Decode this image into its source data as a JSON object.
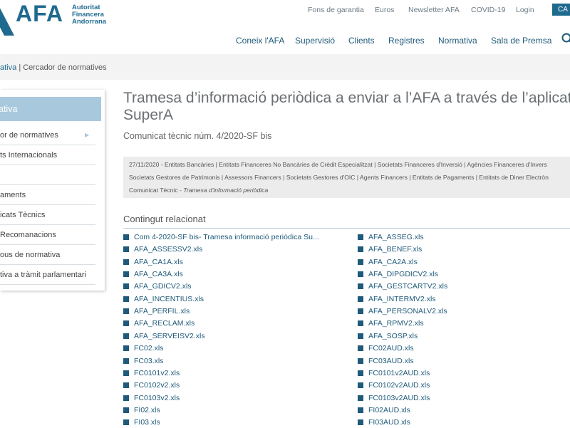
{
  "header": {
    "logo": {
      "text": "AFA",
      "sub_line1": "Autoritat",
      "sub_line2": "Financera",
      "sub_line3": "Andorrana"
    },
    "utility_nav": [
      "Fons de garantia",
      "Euros",
      "Newsletter AFA",
      "COVID-19",
      "Login"
    ],
    "utility_button": "CA",
    "main_nav": [
      "Coneix l'AFA",
      "Supervisió",
      "Clients",
      "Registres",
      "Normativa",
      "Sala de Premsa"
    ],
    "search_icon": "search-icon"
  },
  "breadcrumb": {
    "link": "ativa",
    "separator": "|",
    "current": "Cercador de normatives"
  },
  "sidebar": {
    "header": "ativa",
    "items": [
      {
        "label": "or de normatives",
        "has_arrow": true,
        "arrow": "▶"
      },
      {
        "label": "ts Internacionals"
      },
      {
        "label": ""
      },
      {
        "label": "aments"
      },
      {
        "label": "icats Tècnics"
      },
      {
        "label": " Recomanacions"
      },
      {
        "label": "ous de normativa"
      },
      {
        "label": "tiva a tràmit parlamentari"
      }
    ]
  },
  "content": {
    "title_line1": "Tramesa d’informació periòdica a enviar a l’AFA a través de l’aplicatiu",
    "title_line2": "SuperA",
    "subtitle": "Comunicat tècnic núm. 4/2020-SF bis",
    "meta_line1": "27/11/2020 - Entitats Bancàries | Entitats Financeres No Bancàries de Crèdit Especialitzat | Societats Financeres d'Inversió | Agències Financeres d'Invers",
    "meta_line2": "Societats Gestores de Patrimonis | Assessors Financers | Societats Gestores d'OIC | Agents Financers | Entitats de Pagaments | Entitats de Diner Electròn",
    "meta_line3_prefix": "Comunicat Tècnic - ",
    "meta_line3_italic": "Tramesa d'informació periòdica",
    "related_title": "Contingut relacionat",
    "files_left": [
      "Com 4-2020-SF bis- Tramesa informació periòdica Su...",
      "AFA_ASSESSV2.xls",
      "AFA_CA1A.xls",
      "AFA_CA3A.xls",
      "AFA_GDICV2.xls",
      "AFA_INCENTIUS.xls",
      "AFA_PERFIL.xls",
      "AFA_RECLAM.xls",
      "AFA_SERVEISV2.xls",
      "FC02.xls",
      "FC03.xls",
      "FC0101v2.xls",
      "FC0102v2.xls",
      "FC0103v2.xls",
      "FI02.xls",
      "FI03.xls"
    ],
    "files_right": [
      "AFA_ASSEG.xls",
      "AFA_BENEF.xls",
      "AFA_CA2A.xls",
      "AFA_DIPGDICV2.xls",
      "AFA_GESTCARTV2.xls",
      "AFA_INTERMV2.xls",
      "AFA_PERSONALV2.xls",
      "AFA_RPMV2.xls",
      "AFA_SOSP.xls",
      "FC02AUD.xls",
      "FC03AUD.xls",
      "FC0101v2AUD.xls",
      "FC0102v2AUD.xls",
      "FC0103v2AUD.xls",
      "FI02AUD.xls",
      "FI03AUD.xls"
    ]
  },
  "colors": {
    "brand": "#1f6a8f",
    "sidebar_header": "#a8c8de",
    "link": "#1f5a7a"
  }
}
